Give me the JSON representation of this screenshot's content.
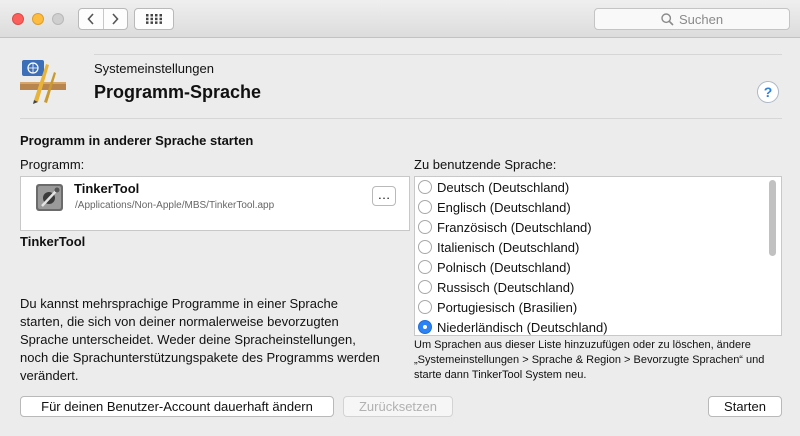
{
  "toolbar": {
    "search_placeholder": "Suchen",
    "icons": [
      "back-icon",
      "forward-icon",
      "grid-icon",
      "search-icon"
    ]
  },
  "header": {
    "subtitle": "Systemeinstellungen",
    "title": "Programm-Sprache",
    "help_label": "?"
  },
  "section": {
    "heading": "Programm in anderer Sprache starten",
    "program_label": "Programm:",
    "language_label": "Zu benutzende Sprache:"
  },
  "program": {
    "name": "TinkerTool",
    "path": "/Applications/Non-Apple/MBS/TinkerTool.app",
    "choose_label": "…",
    "selected_name": "TinkerTool"
  },
  "description": "Du kannst mehrsprachige Programme in einer Sprache starten, die sich von deiner normalerweise bevorzugten Sprache unterscheidet. Weder deine Spracheinstellungen, noch die Sprachunterstützungspakete des Programms werden verändert.",
  "languages": [
    {
      "label": "Deutsch (Deutschland)",
      "selected": false
    },
    {
      "label": "Englisch (Deutschland)",
      "selected": false
    },
    {
      "label": "Französisch (Deutschland)",
      "selected": false
    },
    {
      "label": "Italienisch (Deutschland)",
      "selected": false
    },
    {
      "label": "Polnisch (Deutschland)",
      "selected": false
    },
    {
      "label": "Russisch (Deutschland)",
      "selected": false
    },
    {
      "label": "Portugiesisch (Brasilien)",
      "selected": false
    },
    {
      "label": "Niederländisch (Deutschland)",
      "selected": true
    }
  ],
  "hint": "Um Sprachen aus dieser Liste hinzuzufügen oder zu löschen, ändere „Systemeinstellungen > Sprache & Region > Bevorzugte Sprachen“ und starte dann TinkerTool System neu.",
  "buttons": {
    "permanent": "Für deinen Benutzer-Account dauerhaft ändern",
    "reset": "Zurücksetzen",
    "start": "Starten"
  },
  "colors": {
    "accent": "#2a82f7",
    "help": "#2f7fdd"
  }
}
